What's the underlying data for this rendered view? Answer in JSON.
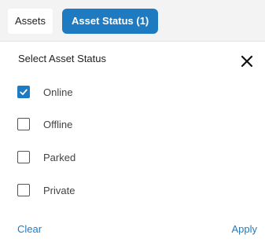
{
  "tabs": [
    {
      "label": "Assets",
      "active": false
    },
    {
      "label": "Asset Status (1)",
      "active": true
    }
  ],
  "panel": {
    "title": "Select Asset Status",
    "close_icon": "close-icon"
  },
  "options": [
    {
      "label": "Online",
      "checked": true
    },
    {
      "label": "Offline",
      "checked": false
    },
    {
      "label": "Parked",
      "checked": false
    },
    {
      "label": "Private",
      "checked": false
    }
  ],
  "footer": {
    "clear_label": "Clear",
    "apply_label": "Apply"
  },
  "colors": {
    "accent": "#1f7bc1",
    "tabbar_bg": "#f3f3f3"
  }
}
